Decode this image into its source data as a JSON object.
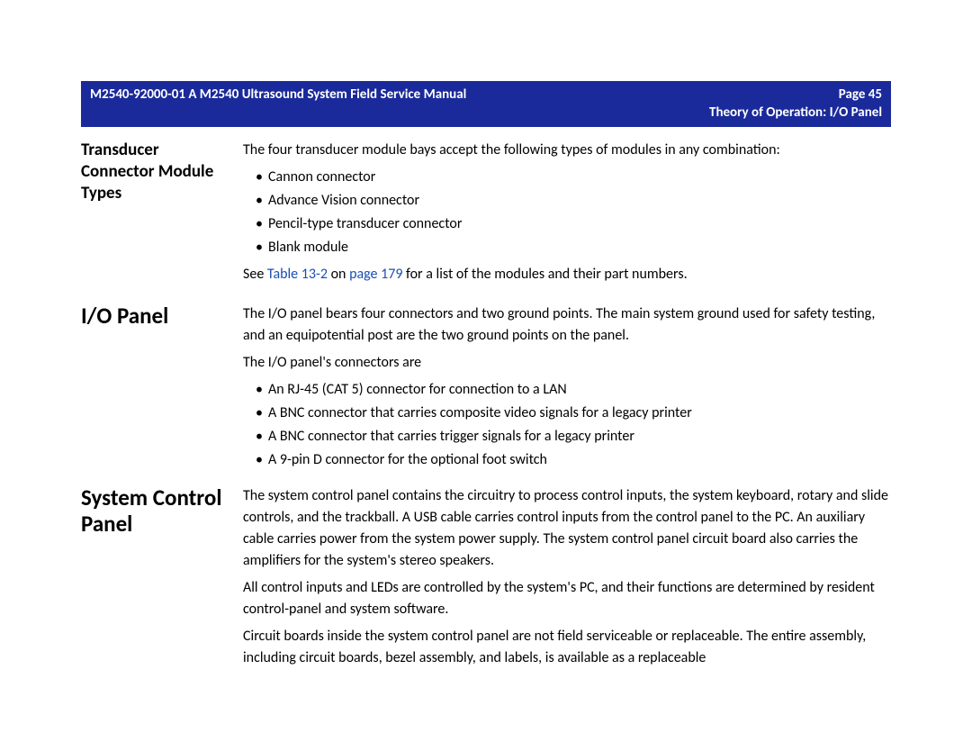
{
  "banner": {
    "left": "M2540-92000-01 A M2540 Ultrasound System Field Service Manual",
    "right": "Page 45",
    "subright": "Theory of Operation: I/O Panel"
  },
  "sections": {
    "transducer": {
      "heading": "Transducer Connector Module Types",
      "intro": "The four transducer module bays accept the following types of modules in any combination:",
      "bullets": [
        "Cannon connector",
        "Advance Vision connector",
        "Pencil-type transducer connector",
        "Blank module"
      ],
      "see_prefix": "See ",
      "see_link1": "Table 13-2",
      "see_mid": " on ",
      "see_link2": "page 179",
      "see_suffix": " for a list of the modules and their part numbers."
    },
    "iopanel": {
      "heading": "I/O Panel",
      "p1": "The I/O panel bears four connectors and two ground points. The main system ground used for safety testing, and an equipotential post are the two ground points on the panel.",
      "p2": "The I/O panel's connectors are",
      "bullets": [
        "An RJ-45 (CAT 5) connector for connection to a LAN",
        "A BNC connector that carries composite video signals for a legacy printer",
        "A BNC connector that carries trigger signals for a legacy printer",
        "A 9-pin D connector for the optional foot switch"
      ]
    },
    "syscp": {
      "heading": "System Control Panel",
      "p1": "The system control panel contains the circuitry to process control inputs, the system keyboard, rotary and slide controls, and the trackball. A USB cable carries control inputs from the control panel to the PC. An auxiliary cable carries power from the system power supply. The system control panel circuit board also carries the amplifiers for the system's stereo speakers.",
      "p2": "All control inputs and LEDs are controlled by the system's PC, and their functions are determined by resident control-panel and system software.",
      "p3": "Circuit boards inside the system control panel are not field serviceable or replaceable. The entire assembly, including circuit boards, bezel assembly, and labels, is available as a replaceable"
    }
  }
}
